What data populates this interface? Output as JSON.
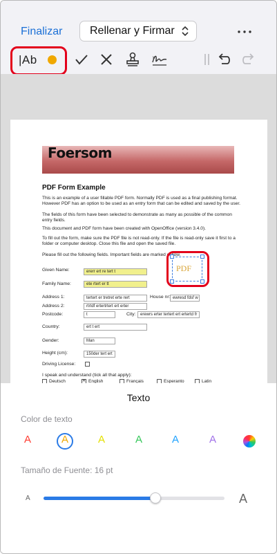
{
  "header": {
    "done_label": "Finalizar",
    "mode_label": "Rellenar y Firmar"
  },
  "toolbar": {
    "text_tool_label": "|Ab"
  },
  "document": {
    "brand_title": "Foersom",
    "form_title": "PDF Form Example",
    "paragraphs": [
      "This is an example of a user fillable PDF form. Normally PDF is used as a final publishing format. However PDF has an option to be used as an entry form that can be edited and saved by the user.",
      "The fields of this form have been selected to demonstrate as many as possible of the common entry fields.",
      "This document and PDF form have been created with OpenOffice (version 3.4.0).",
      "To fill out the form, make sure the PDF file is not read-only. If the file is read-only save it first to a folder or computer desktop. Close this file and open the saved file.",
      "Please fill out the following fields. Important fields are marked yellow."
    ],
    "labels": {
      "given_name": "Given Name:",
      "family_name": "Family Name:",
      "address1": "Address 1:",
      "house_nr": "House nr:",
      "address2": "Address 2:",
      "postcode": "Postcode:",
      "city": "City:",
      "country": "Country:",
      "gender": "Gender:",
      "height": "Height (cm):",
      "driving_license": "Driving License:",
      "languages": "I speak and understand (tick all that apply):"
    },
    "values": {
      "given_name": "ererr ert re tert t",
      "family_name": "ete rtert er tt",
      "address1": "tertert er tretret  erte rert",
      "house_nr": "ewresd fdsf w",
      "address2": "rtrtdf ertertrtert ert erter",
      "postcode": "t",
      "city": "erewrs erter tertert ert ertertd fr",
      "country": "ert t ert",
      "gender": "Man",
      "height": "150der tert ert"
    },
    "languages": [
      "Deutsch",
      "English",
      "Français",
      "Esperanto",
      "Latin"
    ],
    "stamp_text": "PDF"
  },
  "sheet": {
    "title": "Texto",
    "color_label": "Color de texto",
    "colors": [
      {
        "glyph": "A",
        "hex": "#ff3b30"
      },
      {
        "glyph": "A",
        "hex": "#f0a800"
      },
      {
        "glyph": "A",
        "hex": "#e4e000"
      },
      {
        "glyph": "A",
        "hex": "#34c759"
      },
      {
        "glyph": "A",
        "hex": "#1fa2ff"
      },
      {
        "glyph": "A",
        "hex": "#a070e8"
      }
    ],
    "selected_color_index": 1,
    "font_size_label": "Tamaño de Fuente: 16 pt",
    "size_small_glyph": "A",
    "size_large_glyph": "A",
    "font_size_fraction": 0.62
  }
}
